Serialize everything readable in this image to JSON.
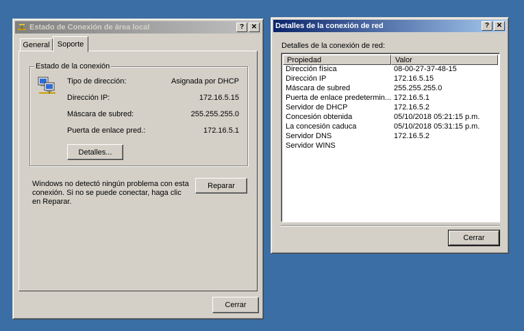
{
  "status_window": {
    "title": "Estado de Conexión de área local",
    "tabs": [
      {
        "label": "General"
      },
      {
        "label": "Soporte"
      }
    ],
    "group_title": "Estado de la conexión",
    "fields": [
      {
        "label": "Tipo de dirección:",
        "value": "Asignada por DHCP"
      },
      {
        "label": "Dirección IP:",
        "value": "172.16.5.15"
      },
      {
        "label": "Máscara de subred:",
        "value": "255.255.255.0"
      },
      {
        "label": "Puerta de enlace pred.:",
        "value": "172.16.5.1"
      }
    ],
    "details_button": "Detalles...",
    "repair_message": "Windows no detectó ningún problema con esta conexión. Si no se puede conectar, haga clic en Reparar.",
    "repair_button": "Reparar",
    "close_button": "Cerrar",
    "help_button": "?",
    "x_button": "✕"
  },
  "details_window": {
    "title": "Detalles de la conexión de red",
    "caption": "Detalles de la conexión de red:",
    "columns": [
      "Propiedad",
      "Valor"
    ],
    "rows": [
      {
        "prop": "Dirección física",
        "value": "08-00-27-37-48-15"
      },
      {
        "prop": "Dirección IP",
        "value": "172.16.5.15"
      },
      {
        "prop": "Máscara de subred",
        "value": "255.255.255.0"
      },
      {
        "prop": "Puerta de enlace predetermin...",
        "value": "172.16.5.1"
      },
      {
        "prop": "Servidor de DHCP",
        "value": "172.16.5.2"
      },
      {
        "prop": "Concesión obtenida",
        "value": "05/10/2018 05:21:15 p.m."
      },
      {
        "prop": "La concesión caduca",
        "value": "05/10/2018 05:31:15 p.m."
      },
      {
        "prop": "Servidor DNS",
        "value": "172.16.5.2"
      },
      {
        "prop": "Servidor WINS",
        "value": ""
      }
    ],
    "close_button": "Cerrar",
    "help_button": "?",
    "x_button": "✕"
  },
  "colors": {
    "desktop": "#3a6ea5",
    "window_face": "#d4d0c8",
    "active_title": "#0a246a",
    "inactive_title": "#808080"
  }
}
